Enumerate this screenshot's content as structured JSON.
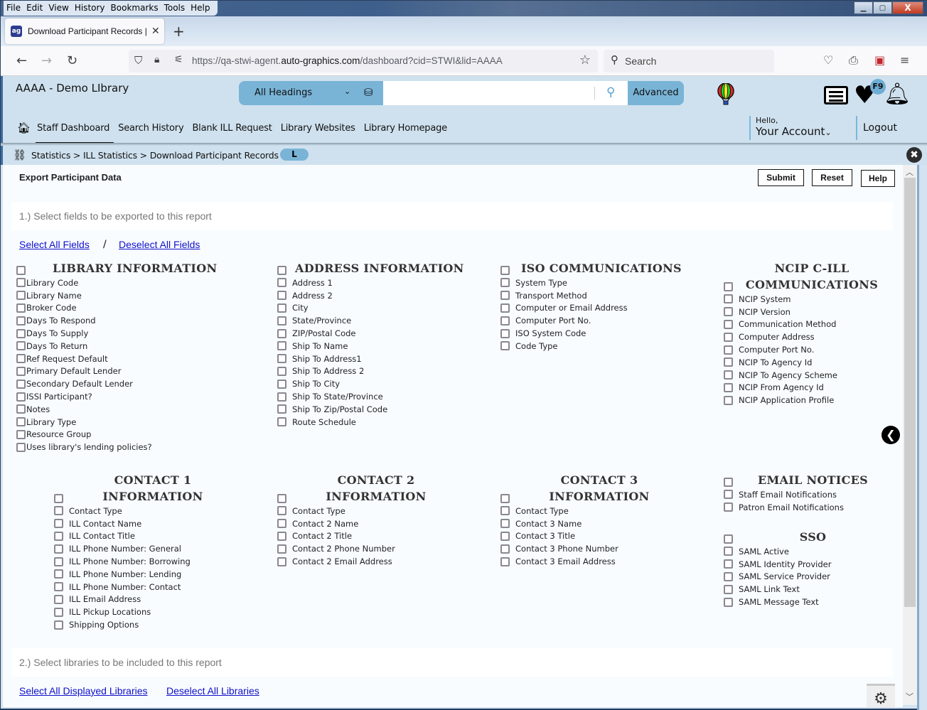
{
  "browser": {
    "menu": [
      "File",
      "Edit",
      "View",
      "History",
      "Bookmarks",
      "Tools",
      "Help"
    ],
    "tab_title": "Download Participant Records | Aut",
    "url_prefix": "https://qa-stwi-agent.",
    "url_domain": "auto-graphics.com",
    "url_suffix": "/dashboard?cid=STWI&lid=AAAA",
    "search_placeholder": "Search"
  },
  "header": {
    "library_name": "AAAA - Demo LIbrary",
    "search_scope": "All Headings",
    "search_value": "",
    "advanced_label": "Advanced",
    "badge": "F9",
    "nav": [
      "Staff Dashboard",
      "Search History",
      "Blank ILL Request",
      "Library Websites",
      "Library Homepage"
    ],
    "hello": "Hello,",
    "account": "Your Account",
    "logout": "Logout"
  },
  "breadcrumb": {
    "path": "Statistics > ILL Statistics > Download Participant Records",
    "pill": "L"
  },
  "page": {
    "title": "Export Participant Data",
    "buttons": {
      "submit": "Submit",
      "reset": "Reset",
      "help": "Help"
    },
    "step1": "1.) Select fields to be exported to this report",
    "select_all_fields": "Select All Fields",
    "separator": "/",
    "deselect_all_fields": "Deselect All Fields",
    "step2": "2.) Select libraries to be included to this report",
    "select_all_libraries": "Select All Displayed Libraries",
    "deselect_all_libraries": "Deselect All Libraries"
  },
  "groups": {
    "library": {
      "title": "LIBRARY INFORMATION",
      "fields": [
        "Library Code",
        "Library Name",
        "Broker Code",
        "Days To Respond",
        "Days To Supply",
        "Days To Return",
        "Ref Request Default",
        "Primary Default Lender",
        "Secondary Default Lender",
        "ISSI Participant?",
        "Notes",
        "Library Type",
        "Resource Group",
        "Uses library's lending policies?"
      ]
    },
    "address": {
      "title": "ADDRESS INFORMATION",
      "fields": [
        "Address 1",
        "Address 2",
        "City",
        "State/Province",
        "ZIP/Postal Code",
        "Ship To Name",
        "Ship To Address1",
        "Ship To Address 2",
        "Ship To City",
        "Ship To State/Province",
        "Ship To Zip/Postal Code",
        "Route Schedule"
      ]
    },
    "iso": {
      "title": "ISO COMMUNICATIONS",
      "fields": [
        "System Type",
        "Transport Method",
        "Computer or Email Address",
        "Computer Port No.",
        "ISO System Code",
        "Code Type"
      ]
    },
    "ncip": {
      "title_line1": "NCIP C-ILL",
      "title_line2": "COMMUNICATIONS",
      "fields": [
        "NCIP System",
        "NCIP Version",
        "Communication Method",
        "Computer Address",
        "Computer Port No.",
        "NCIP To Agency Id",
        "NCIP To Agency Scheme",
        "NCIP From Agency Id",
        "NCIP Application Profile"
      ]
    },
    "contact1": {
      "title_line1": "CONTACT 1",
      "title_line2": "INFORMATION",
      "fields": [
        "Contact Type",
        "ILL Contact Name",
        "ILL Contact Title",
        "ILL Phone Number: General",
        "ILL Phone Number: Borrowing",
        "ILL Phone Number: Lending",
        "ILL Phone Number: Contact",
        "ILL Email Address",
        "ILL Pickup Locations",
        "Shipping Options"
      ]
    },
    "contact2": {
      "title_line1": "CONTACT 2",
      "title_line2": "INFORMATION",
      "fields": [
        "Contact Type",
        "Contact 2 Name",
        "Contact 2 Title",
        "Contact 2 Phone Number",
        "Contact 2 Email Address"
      ]
    },
    "contact3": {
      "title_line1": "CONTACT 3",
      "title_line2": "INFORMATION",
      "fields": [
        "Contact Type",
        "Contact 3 Name",
        "Contact 3 Title",
        "Contact 3 Phone Number",
        "Contact 3 Email Address"
      ]
    },
    "email": {
      "title": "EMAIL NOTICES",
      "fields": [
        "Staff Email Notifications",
        "Patron Email Notifications"
      ]
    },
    "sso": {
      "title": "SSO",
      "fields": [
        "SAML Active",
        "SAML Identity Provider",
        "SAML Service Provider",
        "SAML Link Text",
        "SAML Message Text"
      ]
    }
  }
}
